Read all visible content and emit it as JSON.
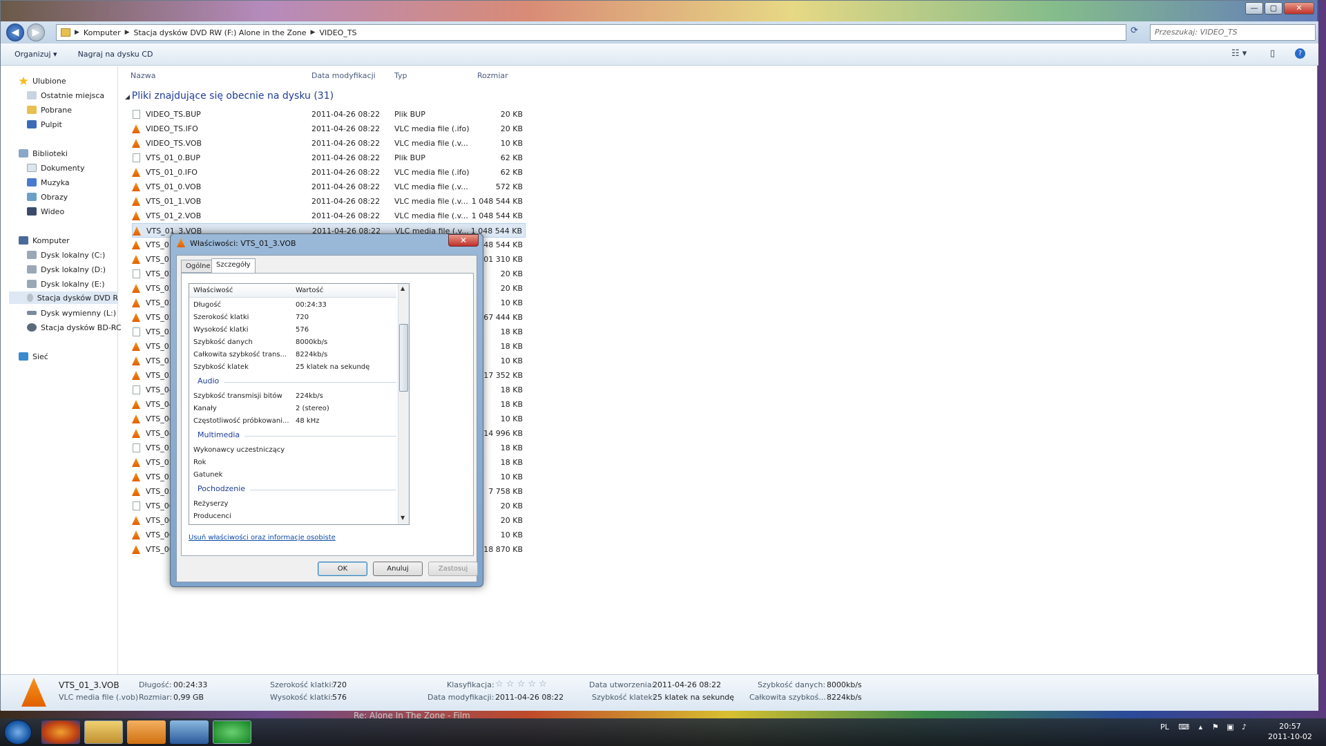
{
  "window": {
    "controls": {
      "min": "—",
      "max": "▢",
      "close": "✕"
    },
    "address_parts": [
      "Komputer",
      "Stacja dysków DVD RW (F:) Alone in the Zone",
      "VIDEO_TS"
    ],
    "search_placeholder": "Przeszukaj: VIDEO_TS"
  },
  "toolbar": {
    "organize": "Organizuj ▾",
    "burn": "Nagraj na dysku CD"
  },
  "sidebar": {
    "favorites": "Ulubione",
    "fav_items": [
      "Ostatnie miejsca",
      "Pobrane",
      "Pulpit"
    ],
    "libraries": "Biblioteki",
    "lib_items": [
      "Dokumenty",
      "Muzyka",
      "Obrazy",
      "Wideo"
    ],
    "computer": "Komputer",
    "comp_items": [
      "Dysk lokalny (C:)",
      "Dysk lokalny (D:)",
      "Dysk lokalny (E:)",
      "Stacja dysków DVD R",
      "Dysk wymienny (L:)",
      "Stacja dysków BD-RC"
    ],
    "network": "Sieć"
  },
  "columns": {
    "name": "Nazwa",
    "date": "Data modyfikacji",
    "type": "Typ",
    "size": "Rozmiar"
  },
  "group_title": "Pliki znajdujące się obecnie na dysku (31)",
  "files": [
    {
      "name": "VIDEO_TS.BUP",
      "date": "2011-04-26 08:22",
      "type": "Plik BUP",
      "size": "20 KB",
      "icon": "doc"
    },
    {
      "name": "VIDEO_TS.IFO",
      "date": "2011-04-26 08:22",
      "type": "VLC media file (.ifo)",
      "size": "20 KB",
      "icon": "vlc"
    },
    {
      "name": "VIDEO_TS.VOB",
      "date": "2011-04-26 08:22",
      "type": "VLC media file (.v...",
      "size": "10 KB",
      "icon": "vlc"
    },
    {
      "name": "VTS_01_0.BUP",
      "date": "2011-04-26 08:22",
      "type": "Plik BUP",
      "size": "62 KB",
      "icon": "doc"
    },
    {
      "name": "VTS_01_0.IFO",
      "date": "2011-04-26 08:22",
      "type": "VLC media file (.ifo)",
      "size": "62 KB",
      "icon": "vlc"
    },
    {
      "name": "VTS_01_0.VOB",
      "date": "2011-04-26 08:22",
      "type": "VLC media file (.v...",
      "size": "572 KB",
      "icon": "vlc"
    },
    {
      "name": "VTS_01_1.VOB",
      "date": "2011-04-26 08:22",
      "type": "VLC media file (.v...",
      "size": "1 048 544 KB",
      "icon": "vlc"
    },
    {
      "name": "VTS_01_2.VOB",
      "date": "2011-04-26 08:22",
      "type": "VLC media file (.v...",
      "size": "1 048 544 KB",
      "icon": "vlc"
    },
    {
      "name": "VTS_01_3.VOB",
      "date": "2011-04-26 08:22",
      "type": "VLC media file (.v...",
      "size": "1 048 544 KB",
      "icon": "vlc",
      "selected": true
    },
    {
      "name": "VTS_01",
      "date": "",
      "type": "",
      "size": "048 544 KB",
      "icon": "vlc"
    },
    {
      "name": "VTS_01",
      "date": "",
      "type": "",
      "size": "101 310 KB",
      "icon": "vlc"
    },
    {
      "name": "VTS_02",
      "date": "",
      "type": "",
      "size": "20 KB",
      "icon": "doc"
    },
    {
      "name": "VTS_02",
      "date": "",
      "type": "",
      "size": "20 KB",
      "icon": "vlc"
    },
    {
      "name": "VTS_02",
      "date": "",
      "type": "",
      "size": "10 KB",
      "icon": "vlc"
    },
    {
      "name": "VTS_02",
      "date": "",
      "type": "",
      "size": "167 444 KB",
      "icon": "vlc"
    },
    {
      "name": "VTS_03",
      "date": "",
      "type": "",
      "size": "18 KB",
      "icon": "doc"
    },
    {
      "name": "VTS_03",
      "date": "",
      "type": "",
      "size": "18 KB",
      "icon": "vlc"
    },
    {
      "name": "VTS_03",
      "date": "",
      "type": "",
      "size": "10 KB",
      "icon": "vlc"
    },
    {
      "name": "VTS_03",
      "date": "",
      "type": "",
      "size": "17 352 KB",
      "icon": "vlc"
    },
    {
      "name": "VTS_04",
      "date": "",
      "type": "",
      "size": "18 KB",
      "icon": "doc"
    },
    {
      "name": "VTS_04",
      "date": "",
      "type": "",
      "size": "18 KB",
      "icon": "vlc"
    },
    {
      "name": "VTS_04",
      "date": "",
      "type": "",
      "size": "10 KB",
      "icon": "vlc"
    },
    {
      "name": "VTS_04",
      "date": "",
      "type": "",
      "size": "14 996 KB",
      "icon": "vlc"
    },
    {
      "name": "VTS_05",
      "date": "",
      "type": "",
      "size": "18 KB",
      "icon": "doc"
    },
    {
      "name": "VTS_05",
      "date": "",
      "type": "",
      "size": "18 KB",
      "icon": "vlc"
    },
    {
      "name": "VTS_05",
      "date": "",
      "type": "",
      "size": "10 KB",
      "icon": "vlc"
    },
    {
      "name": "VTS_05",
      "date": "",
      "type": "",
      "size": "7 758 KB",
      "icon": "vlc"
    },
    {
      "name": "VTS_06",
      "date": "",
      "type": "",
      "size": "20 KB",
      "icon": "doc"
    },
    {
      "name": "VTS_06",
      "date": "",
      "type": "",
      "size": "20 KB",
      "icon": "vlc"
    },
    {
      "name": "VTS_06",
      "date": "",
      "type": "",
      "size": "10 KB",
      "icon": "vlc"
    },
    {
      "name": "VTS_06",
      "date": "",
      "type": "",
      "size": "18 870 KB",
      "icon": "vlc"
    }
  ],
  "dialog": {
    "title": "Właściwości: VTS_01_3.VOB",
    "close": "✕",
    "tab_general": "Ogólne",
    "tab_details": "Szczegóły",
    "col_property": "Właściwość",
    "col_value": "Wartość",
    "props": [
      {
        "k": "Długość",
        "v": "00:24:33"
      },
      {
        "k": "Szerokość klatki",
        "v": "720"
      },
      {
        "k": "Wysokość klatki",
        "v": "576"
      },
      {
        "k": "Szybkość danych",
        "v": "8000kb/s"
      },
      {
        "k": "Całkowita szybkość trans...",
        "v": "8224kb/s"
      },
      {
        "k": "Szybkość klatek",
        "v": "25 klatek na sekundę"
      }
    ],
    "group_audio": "Audio",
    "audio": [
      {
        "k": "Szybkość transmisji bitów",
        "v": "224kb/s"
      },
      {
        "k": "Kanały",
        "v": "2 (stereo)"
      },
      {
        "k": "Częstotliwość próbkowani...",
        "v": "48 kHz"
      }
    ],
    "group_media": "Multimedia",
    "media": [
      {
        "k": "Wykonawcy uczestniczący",
        "v": ""
      },
      {
        "k": "Rok",
        "v": ""
      },
      {
        "k": "Gatunek",
        "v": ""
      }
    ],
    "group_origin": "Pochodzenie",
    "origin": [
      {
        "k": "Reżyserzy",
        "v": ""
      },
      {
        "k": "Producenci",
        "v": ""
      }
    ],
    "remove_link": "Usuń właściwości oraz informacje osobiste",
    "ok": "OK",
    "cancel": "Anuluj",
    "apply": "Zastosuj"
  },
  "details": {
    "filename": "VTS_01_3.VOB",
    "filetype": "VLC media file (.vob)",
    "length_lbl": "Długość:",
    "length": "00:24:33",
    "size_lbl": "Rozmiar:",
    "size": "0,99 GB",
    "width_lbl": "Szerokość klatki:",
    "width": "720",
    "height_lbl": "Wysokość klatki:",
    "height": "576",
    "rating_lbl": "Klasyfikacja:",
    "rating_stars": "☆ ☆ ☆ ☆ ☆",
    "modified_lbl": "Data modyfikacji:",
    "modified": "2011-04-26 08:22",
    "created_lbl": "Data utworzenia:",
    "created": "2011-04-26 08:22",
    "framerate_lbl": "Szybkość klatek:",
    "framerate": "25 klatek na sekundę",
    "datarate_lbl": "Szybkość danych:",
    "datarate": "8000kb/s",
    "total_lbl": "Całkowita szybkoś...",
    "total": "8224kb/s"
  },
  "behind_text": "Re: Alone In The Zone - Film",
  "taskbar": {
    "lang": "PL",
    "time": "20:57",
    "date": "2011-10-02"
  }
}
